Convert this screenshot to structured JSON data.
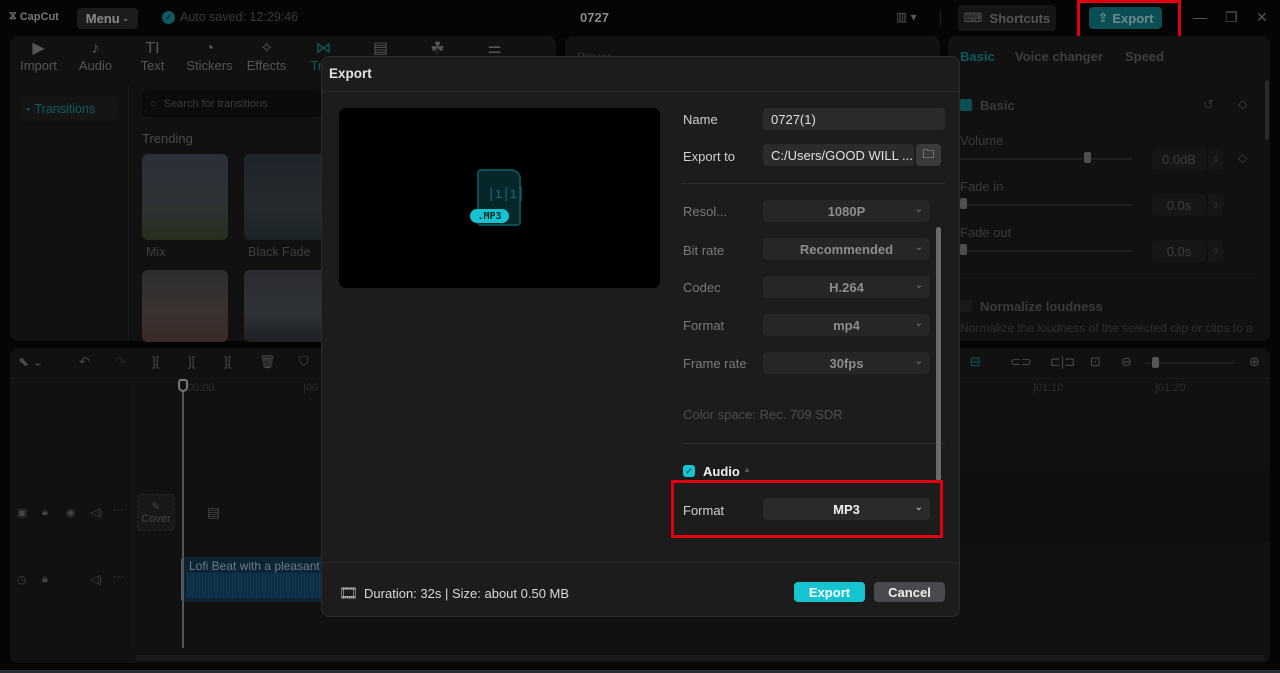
{
  "titlebar": {
    "logo": "CapCut",
    "menu_label": "Menu",
    "autosave": "Auto saved: 12:29:46",
    "project_title": "0727",
    "shortcuts_label": "Shortcuts",
    "export_label": "Export"
  },
  "toolbar": {
    "tools": [
      {
        "label": "Import",
        "icon": "▶"
      },
      {
        "label": "Audio",
        "icon": "♪"
      },
      {
        "label": "Text",
        "icon": "TI"
      },
      {
        "label": "Stickers",
        "icon": "◔"
      },
      {
        "label": "Effects",
        "icon": "✧"
      },
      {
        "label": "Tran",
        "icon": "⋈"
      },
      {
        "label": "",
        "icon": "▤"
      },
      {
        "label": "",
        "icon": "☘"
      },
      {
        "label": "",
        "icon": "⚌"
      }
    ]
  },
  "left_panel": {
    "category": "Transitions",
    "search_placeholder": "Search for transitions",
    "section": "Trending",
    "items": [
      {
        "label": "Mix"
      },
      {
        "label": "Black Fade"
      },
      {
        "label": ""
      },
      {
        "label": ""
      }
    ]
  },
  "player": {
    "label": "Player"
  },
  "right_panel": {
    "tabs": [
      "Basic",
      "Voice changer",
      "Speed"
    ],
    "section_title": "Basic",
    "volume_label": "Volume",
    "volume_value": "0.0dB",
    "fade_in_label": "Fade in",
    "fade_in_value": "0.0s",
    "fade_out_label": "Fade out",
    "fade_out_value": "0.0s",
    "normalize_label": "Normalize loudness",
    "normalize_desc": "Normalize the loudness of the selected clip or clips to a"
  },
  "timeline": {
    "ruler": [
      "00:00",
      "|00",
      "|01:10",
      "|01:20"
    ],
    "cover_label": "Cover",
    "audio_clip_label": "Lofi Beat with a pleasant c"
  },
  "export_dialog": {
    "title": "Export",
    "preview_badge": ".MP3",
    "name_label": "Name",
    "name_value": "0727(1)",
    "export_to_label": "Export to",
    "export_to_value": "C:/Users/GOOD WILL ...",
    "resolution_label": "Resol...",
    "resolution_value": "1080P",
    "bitrate_label": "Bit rate",
    "bitrate_value": "Recommended",
    "codec_label": "Codec",
    "codec_value": "H.264",
    "format_label": "Format",
    "format_value": "mp4",
    "framerate_label": "Frame rate",
    "framerate_value": "30fps",
    "colorspace": "Color space: Rec. 709 SDR",
    "audio_label": "Audio",
    "audio_format_label": "Format",
    "audio_format_value": "MP3",
    "footer_info": "Duration: 32s | Size: about 0.50 MB",
    "export_button": "Export",
    "cancel_button": "Cancel"
  },
  "colors": {
    "accent": "#16c3d0",
    "highlight_box": "#e0000f",
    "dialog_bg": "#1c1c1d"
  }
}
